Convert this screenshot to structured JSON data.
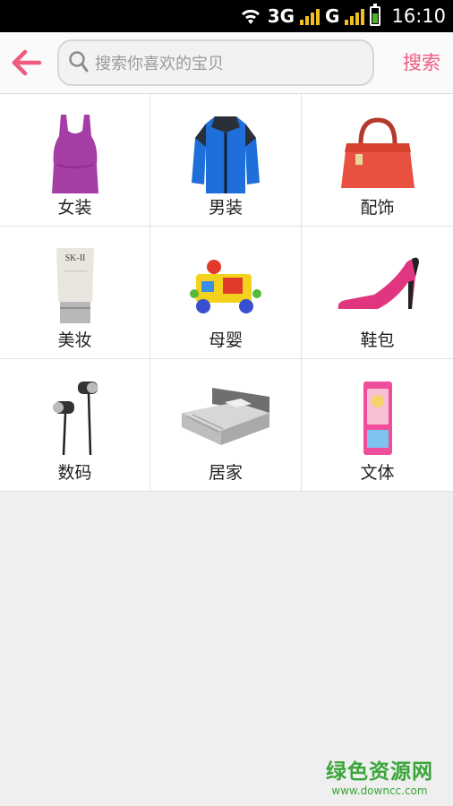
{
  "status_bar": {
    "network_1": "3G",
    "network_2": "G",
    "time": "16:10",
    "signal_color": "#f0c020",
    "battery_level": 0.6
  },
  "header": {
    "search_placeholder": "搜索你喜欢的宝贝",
    "search_button": "搜索",
    "accent_color": "#ef5a7e"
  },
  "categories": [
    {
      "label": "女装",
      "icon": "tank-top-icon"
    },
    {
      "label": "男装",
      "icon": "jacket-icon"
    },
    {
      "label": "配饰",
      "icon": "handbag-icon"
    },
    {
      "label": "美妆",
      "icon": "skincare-tube-icon"
    },
    {
      "label": "母婴",
      "icon": "toy-car-icon"
    },
    {
      "label": "鞋包",
      "icon": "high-heel-icon"
    },
    {
      "label": "数码",
      "icon": "earphones-icon"
    },
    {
      "label": "居家",
      "icon": "bed-icon"
    },
    {
      "label": "文体",
      "icon": "pencil-case-icon"
    }
  ],
  "cosmetic_brand": "SK-II",
  "watermark": {
    "name": "绿色资源网",
    "url": "www.downcc.com"
  }
}
